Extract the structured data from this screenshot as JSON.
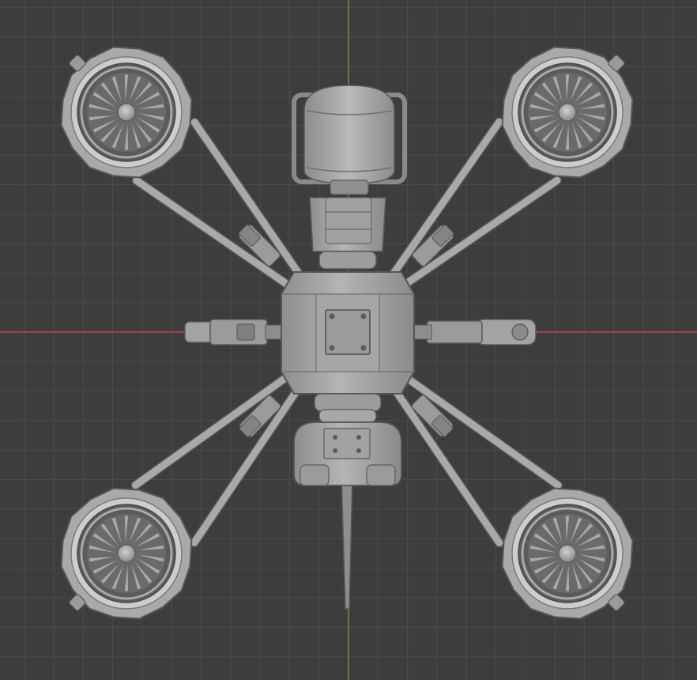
{
  "viewport": {
    "kind": "3d-viewport-top-orthographic",
    "background_color": "#3d3d3d",
    "grid_line_color": "#4b4b4b",
    "x_axis_color": "#b04a4f",
    "y_axis_color": "#6f9a34"
  },
  "model": {
    "name": "quadcopter-drone",
    "base_color": "#a9a9a9",
    "shadow_color": "#6e6e6e",
    "highlight_color": "#cdcdcd",
    "outline_color": "#575757",
    "rotor_count": 4,
    "side_arm_count": 2,
    "turbine_blades": 18
  }
}
